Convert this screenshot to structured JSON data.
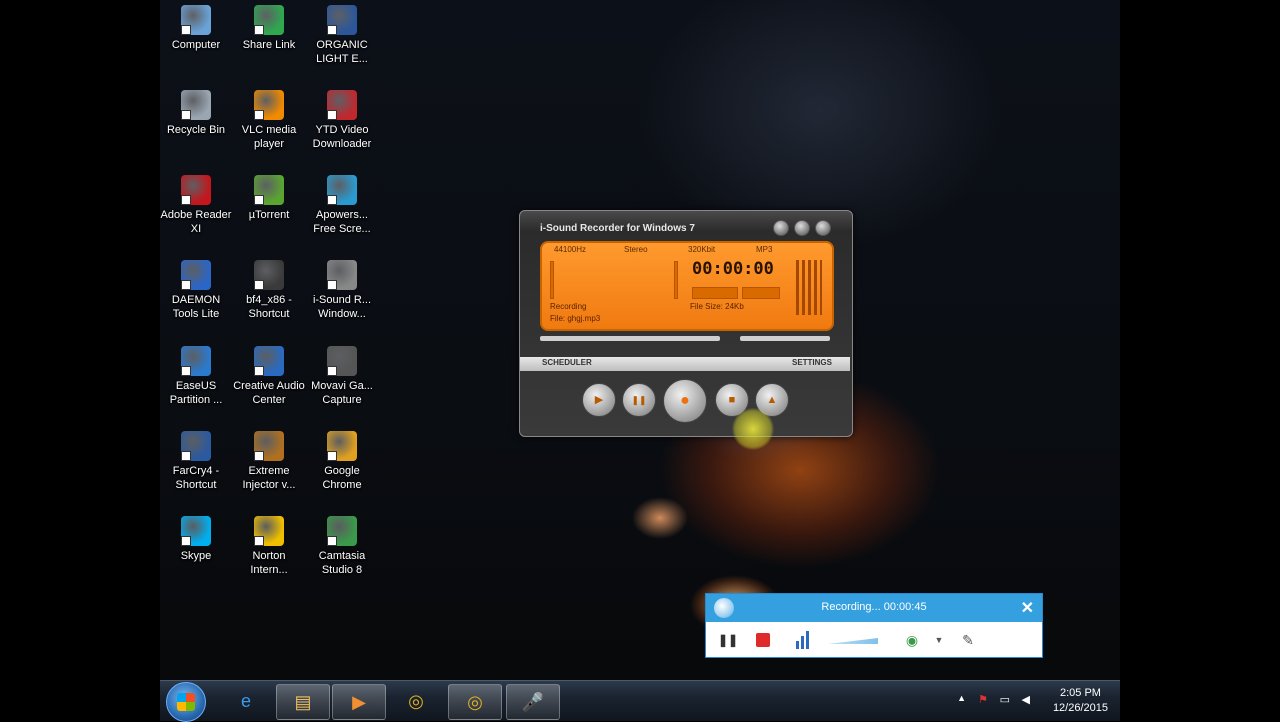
{
  "desktop_icons": [
    {
      "label": "Computer",
      "icon": "computer-icon",
      "color": "#6aa3d8"
    },
    {
      "label": "Share Link",
      "icon": "share-link-icon",
      "color": "#2fa84f"
    },
    {
      "label": "ORGANIC LIGHT E...",
      "icon": "word-document-icon",
      "color": "#2b579a"
    },
    {
      "label": "Recycle Bin",
      "icon": "recycle-bin-icon",
      "color": "#9aa6b2"
    },
    {
      "label": "VLC media player",
      "icon": "vlc-icon",
      "color": "#f08a00"
    },
    {
      "label": "YTD Video Downloader",
      "icon": "ytd-icon",
      "color": "#c0282e"
    },
    {
      "label": "Adobe Reader XI",
      "icon": "adobe-reader-icon",
      "color": "#c4161c"
    },
    {
      "label": "µTorrent",
      "icon": "utorrent-icon",
      "color": "#5aa530"
    },
    {
      "label": "Apowers... Free Scre...",
      "icon": "apowersoft-icon",
      "color": "#2a9ad0"
    },
    {
      "label": "DAEMON Tools Lite",
      "icon": "daemon-tools-icon",
      "color": "#2a66c8"
    },
    {
      "label": "bf4_x86 - Shortcut",
      "icon": "bf4-icon",
      "color": "#3a3a3a"
    },
    {
      "label": "i-Sound R... Window...",
      "icon": "microphone-icon",
      "color": "#888888"
    },
    {
      "label": "EaseUS Partition ...",
      "icon": "easeus-icon",
      "color": "#2a7ad0"
    },
    {
      "label": "Creative Audio Center",
      "icon": "creative-audio-icon",
      "color": "#2a6ac0"
    },
    {
      "label": "Movavi Ga... Capture",
      "icon": "movavi-icon",
      "color": "#555555"
    },
    {
      "label": "FarCry4 - Shortcut",
      "icon": "farcry4-icon",
      "color": "#2a5aa0"
    },
    {
      "label": "Extreme Injector v...",
      "icon": "injector-icon",
      "color": "#b07020"
    },
    {
      "label": "Google Chrome",
      "icon": "chrome-icon",
      "color": "#e0a020"
    },
    {
      "label": "Skype",
      "icon": "skype-icon",
      "color": "#00aff0"
    },
    {
      "label": "Norton Intern...",
      "icon": "norton-icon",
      "color": "#f0c000"
    },
    {
      "label": "Camtasia Studio 8",
      "icon": "camtasia-icon",
      "color": "#3a9a4a"
    }
  ],
  "recorder": {
    "title": "i-Sound Recorder for Windows 7",
    "sample_rate": "44100Hz",
    "channels": "Stereo",
    "bitrate": "320Kbit",
    "format": "MP3",
    "time": "00:00:00",
    "status": "Recording",
    "file": "File: ghgj.mp3",
    "file_size": "File Size: 24Kb",
    "scheduler_label": "SCHEDULER",
    "settings_label": "SETTINGS",
    "buttons": {
      "play": "▶",
      "pause": "❚❚",
      "record": "●",
      "stop": "■",
      "eject": "▲"
    }
  },
  "camtasia": {
    "status": "Recording... 00:00:45",
    "close": "✕"
  },
  "taskbar": {
    "items": [
      "ie-icon",
      "explorer-icon",
      "media-player-icon",
      "chrome-icon",
      "chrome-icon",
      "microphone-icon"
    ],
    "time": "2:05 PM",
    "date": "12/26/2015"
  }
}
